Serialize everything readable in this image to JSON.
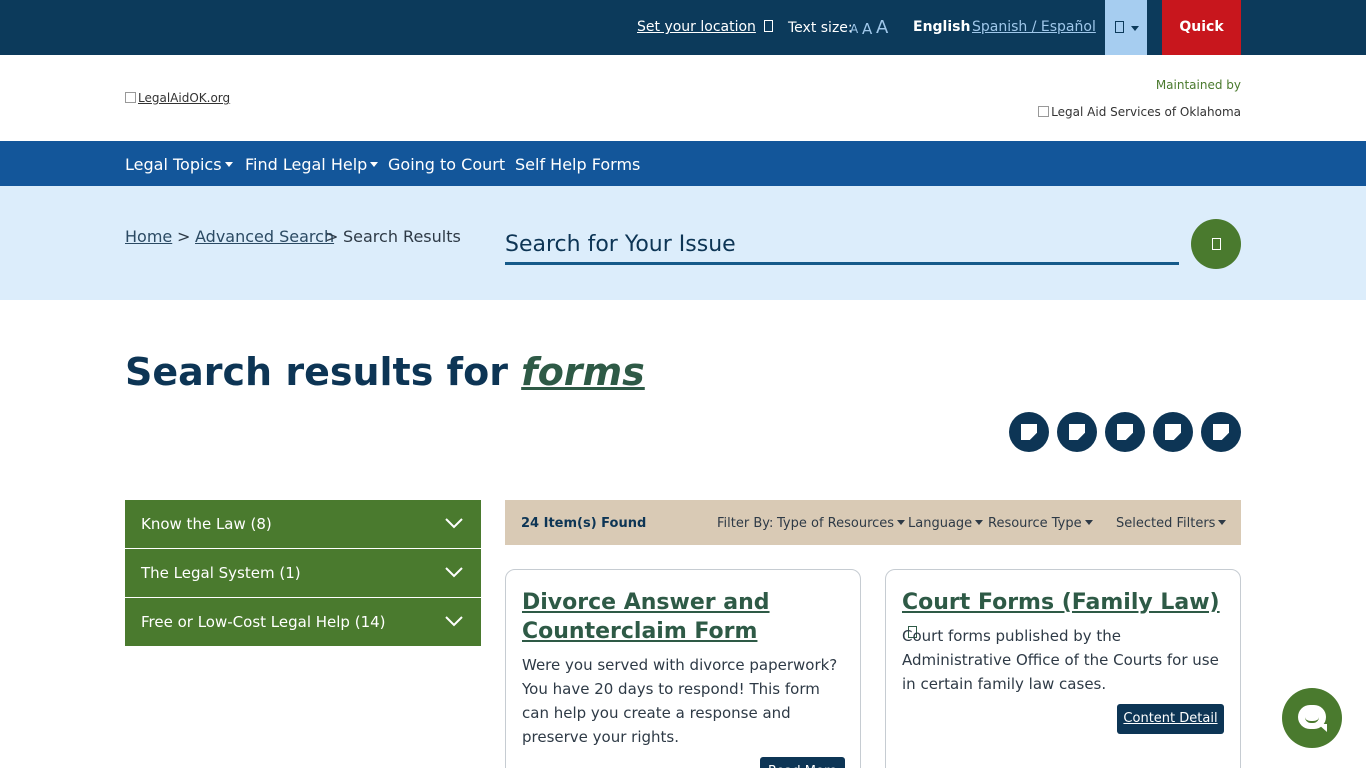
{
  "topbar": {
    "location_label": "Set your location",
    "text_size_label": "Text size:",
    "text_size_options": [
      "A",
      "A",
      "A"
    ],
    "lang_english": "English",
    "lang_spanish": "Spanish / Español",
    "quick_exit": "Quick Exit"
  },
  "header": {
    "logo_alt": "LegalAidOK.org",
    "maintained_by": "Maintained by",
    "partner_alt": "Legal Aid Services of Oklahoma"
  },
  "nav": {
    "items": [
      {
        "label": "Legal Topics",
        "dropdown": true
      },
      {
        "label": "Find Legal Help",
        "dropdown": true
      },
      {
        "label": "Going to Court",
        "dropdown": false
      },
      {
        "label": "Self Help Forms",
        "dropdown": false
      }
    ]
  },
  "breadcrumb": {
    "home": "Home",
    "sep": ">",
    "advanced": "Advanced Search",
    "current": "Search Results"
  },
  "search": {
    "placeholder": "Search for Your Issue"
  },
  "results": {
    "heading_prefix": "Search results for ",
    "term": "forms",
    "count": "24 Item(s) Found"
  },
  "share_icons": [
    "share-image-icon",
    "share-image-icon",
    "share-image-icon",
    "share-image-icon",
    "share-image-icon"
  ],
  "categories": [
    {
      "label": "Know the Law (8)"
    },
    {
      "label": "The Legal System (1)"
    },
    {
      "label": "Free or Low-Cost Legal Help (14)"
    }
  ],
  "filters": {
    "label": "Filter By:",
    "type_of_resources": "Type of Resources",
    "language": "Language",
    "resource_type": "Resource Type",
    "selected": "Selected Filters"
  },
  "cards": [
    {
      "title": "Divorce Answer and Counterclaim Form",
      "description": "Were you served with divorce paperwork? You have 20 days to respond! This form can help you create a response and preserve your rights.",
      "button": "Read More"
    },
    {
      "title": "Court Forms (Family Law)",
      "description": "Court forms published by the Administrative Office of the Courts for use in certain family law cases.",
      "button": "Content Detail"
    }
  ],
  "colors": {
    "topbar": "#0c3a5b",
    "nav": "#13569a",
    "band": "#dcedfb",
    "green": "#4a7a2e",
    "quick_exit": "#c8161d",
    "filter_bar": "#d9cab5"
  }
}
